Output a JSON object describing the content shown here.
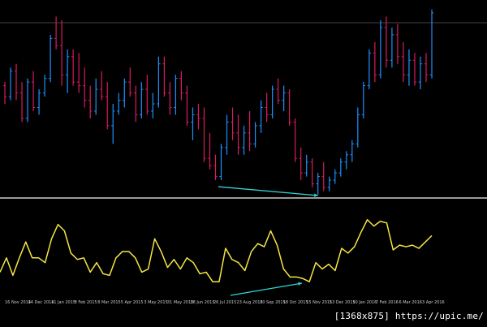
{
  "colors": {
    "background": "#000000",
    "bull_bar": "#1e90ff",
    "bear_bar": "#d81b60",
    "oscillator_line": "#f5e642",
    "divergence_arrow": "#2fd6d6",
    "level_line": "#8a8a8a",
    "divider": "#9a9a9a"
  },
  "date_axis": {
    "labels": [
      "16 Nov 2014",
      "14 Dec 2014",
      "11 Jan 2015",
      "8 Feb 2015",
      "8 Mar 2015",
      "5 Apr 2015",
      "3 May 2015",
      "31 May 2015",
      "28 Jun 2015",
      "26 Jul 2015",
      "23 Aug 2015",
      "20 Sep 2015",
      "18 Oct 2015",
      "15 Nov 2015",
      "13 Dec 2015",
      "10 Jan 2016",
      "7 Feb 2016",
      "6 Mar 2016",
      "3 Apr 2016"
    ]
  },
  "footer": {
    "watermark": "[1368x875] https://upic.me/"
  },
  "chart_data": [
    {
      "type": "ohlc",
      "ylim": [
        0,
        100
      ],
      "series": [
        {
          "values": [
            [
              60,
              62,
              50,
              54
            ],
            [
              54,
              70,
              52,
              68
            ],
            [
              68,
              72,
              52,
              56
            ],
            [
              56,
              62,
              40,
              42
            ],
            [
              42,
              64,
              40,
              62
            ],
            [
              62,
              68,
              46,
              48
            ],
            [
              48,
              58,
              44,
              56
            ],
            [
              56,
              66,
              54,
              64
            ],
            [
              64,
              88,
              62,
              86
            ],
            [
              86,
              98,
              80,
              82
            ],
            [
              82,
              96,
              60,
              66
            ],
            [
              66,
              80,
              56,
              76
            ],
            [
              76,
              80,
              60,
              62
            ],
            [
              62,
              78,
              56,
              60
            ],
            [
              60,
              70,
              48,
              52
            ],
            [
              52,
              60,
              42,
              46
            ],
            [
              46,
              64,
              44,
              58
            ],
            [
              58,
              68,
              52,
              54
            ],
            [
              54,
              62,
              36,
              38
            ],
            [
              38,
              50,
              28,
              46
            ],
            [
              46,
              56,
              44,
              52
            ],
            [
              52,
              64,
              48,
              62
            ],
            [
              62,
              70,
              54,
              56
            ],
            [
              56,
              60,
              40,
              44
            ],
            [
              44,
              62,
              42,
              58
            ],
            [
              58,
              66,
              44,
              46
            ],
            [
              46,
              56,
              42,
              50
            ],
            [
              50,
              76,
              48,
              72
            ],
            [
              72,
              76,
              54,
              56
            ],
            [
              56,
              62,
              44,
              48
            ],
            [
              48,
              66,
              44,
              64
            ],
            [
              64,
              68,
              52,
              56
            ],
            [
              56,
              60,
              38,
              40
            ],
            [
              40,
              48,
              30,
              44
            ],
            [
              44,
              50,
              36,
              42
            ],
            [
              42,
              48,
              18,
              20
            ],
            [
              20,
              34,
              14,
              16
            ],
            [
              16,
              22,
              8,
              10
            ],
            [
              10,
              28,
              8,
              26
            ],
            [
              26,
              44,
              22,
              40
            ],
            [
              40,
              48,
              30,
              34
            ],
            [
              34,
              44,
              22,
              26
            ],
            [
              26,
              38,
              22,
              34
            ],
            [
              34,
              46,
              24,
              28
            ],
            [
              28,
              40,
              26,
              38
            ],
            [
              38,
              52,
              34,
              48
            ],
            [
              48,
              56,
              40,
              44
            ],
            [
              44,
              60,
              42,
              58
            ],
            [
              58,
              64,
              50,
              52
            ],
            [
              52,
              60,
              46,
              56
            ],
            [
              56,
              58,
              38,
              40
            ],
            [
              40,
              42,
              18,
              20
            ],
            [
              20,
              26,
              8,
              12
            ],
            [
              12,
              22,
              10,
              18
            ],
            [
              18,
              20,
              4,
              6
            ],
            [
              6,
              12,
              0,
              10
            ],
            [
              10,
              18,
              2,
              4
            ],
            [
              4,
              10,
              2,
              8
            ],
            [
              8,
              14,
              6,
              12
            ],
            [
              12,
              20,
              10,
              18
            ],
            [
              18,
              24,
              14,
              22
            ],
            [
              22,
              30,
              18,
              28
            ],
            [
              28,
              48,
              26,
              44
            ],
            [
              44,
              62,
              42,
              60
            ],
            [
              60,
              80,
              58,
              78
            ],
            [
              78,
              84,
              62,
              66
            ],
            [
              66,
              96,
              64,
              92
            ],
            [
              92,
              98,
              70,
              74
            ],
            [
              74,
              92,
              70,
              88
            ],
            [
              88,
              94,
              72,
              76
            ],
            [
              76,
              84,
              62,
              66
            ],
            [
              66,
              80,
              60,
              74
            ],
            [
              74,
              78,
              60,
              62
            ],
            [
              62,
              76,
              58,
              72
            ],
            [
              72,
              78,
              62,
              66
            ],
            [
              66,
              102,
              64,
              100
            ]
          ]
        }
      ]
    },
    {
      "type": "line",
      "ylim": [
        0,
        100
      ],
      "series": [
        {
          "values": [
            22,
            40,
            18,
            40,
            60,
            40,
            40,
            34,
            64,
            82,
            74,
            46,
            38,
            40,
            22,
            34,
            20,
            18,
            40,
            48,
            48,
            40,
            22,
            26,
            64,
            48,
            28,
            38,
            26,
            40,
            34,
            20,
            22,
            10,
            10,
            52,
            38,
            34,
            24,
            48,
            58,
            54,
            74,
            56,
            26,
            16,
            16,
            14,
            10,
            34,
            26,
            32,
            24,
            52,
            46,
            54,
            72,
            88,
            80,
            86,
            84,
            50,
            56,
            54,
            56,
            52,
            60,
            68
          ]
        }
      ]
    }
  ]
}
